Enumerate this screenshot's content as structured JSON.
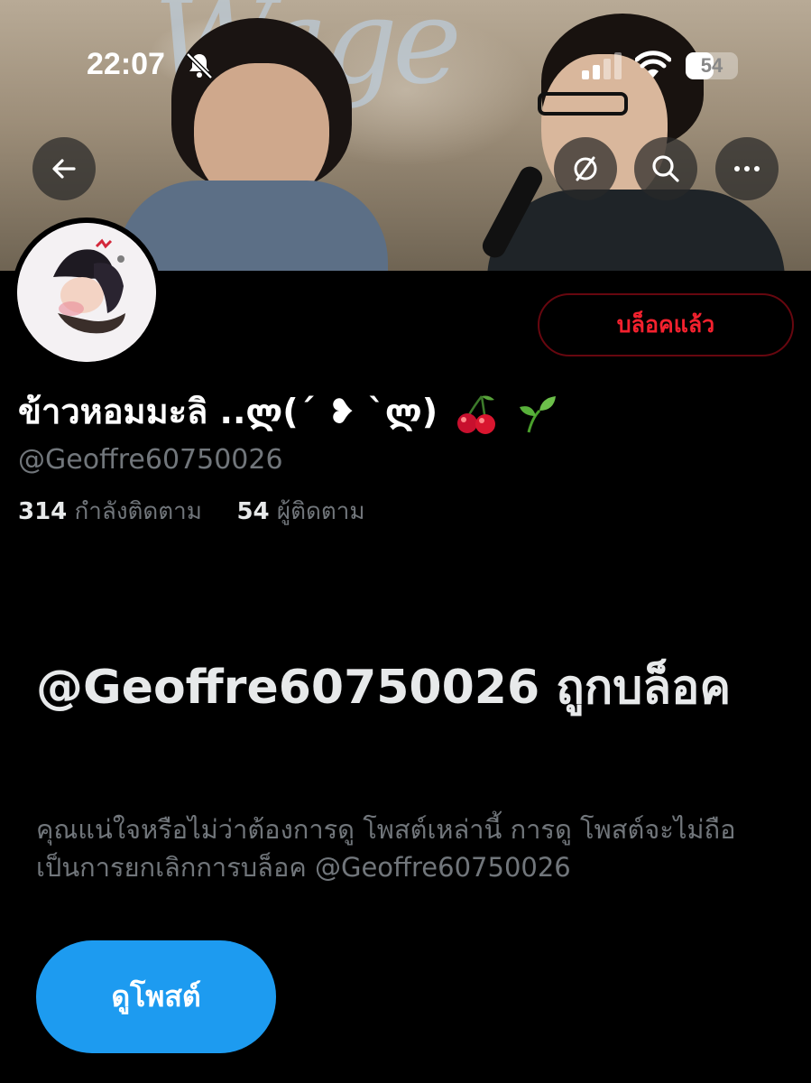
{
  "status_bar": {
    "time": "22:07",
    "battery_level": "54",
    "icons": [
      "bell-slash-icon",
      "cellular-signal-icon",
      "wifi-icon",
      "battery-icon"
    ]
  },
  "header": {
    "banner_image": "profile-banner-photo",
    "buttons": [
      "back-arrow-icon",
      "grok-icon",
      "search-icon",
      "more-icon"
    ]
  },
  "profile": {
    "avatar": "profile-avatar-illustration",
    "block_button_label": "บล็อคแล้ว",
    "display_name": "ข้าวหอมมะลิ ..ლ(´ ❥ `ლ)",
    "name_emojis": [
      "cherry-emoji",
      "seedling-emoji"
    ],
    "handle": "@Geoffre60750026",
    "following_count": "314",
    "following_label": "กำลังติดตาม",
    "followers_count": "54",
    "followers_label": "ผู้ติดตาม"
  },
  "blocked_notice": {
    "title": "@Geoffre60750026 ถูกบล็อค",
    "description": "คุณแน่ใจหรือไม่ว่าต้องการดู โพสต์เหล่านี้ การดู โพสต์จะไม่ถือเป็นการยกเลิกการบล็อค @Geoffre60750026",
    "view_posts_label": "ดูโพสต์"
  },
  "colors": {
    "background": "#000000",
    "accent_blue": "#1d9bf0",
    "block_red": "#f4212e",
    "secondary_text": "#71767b"
  }
}
